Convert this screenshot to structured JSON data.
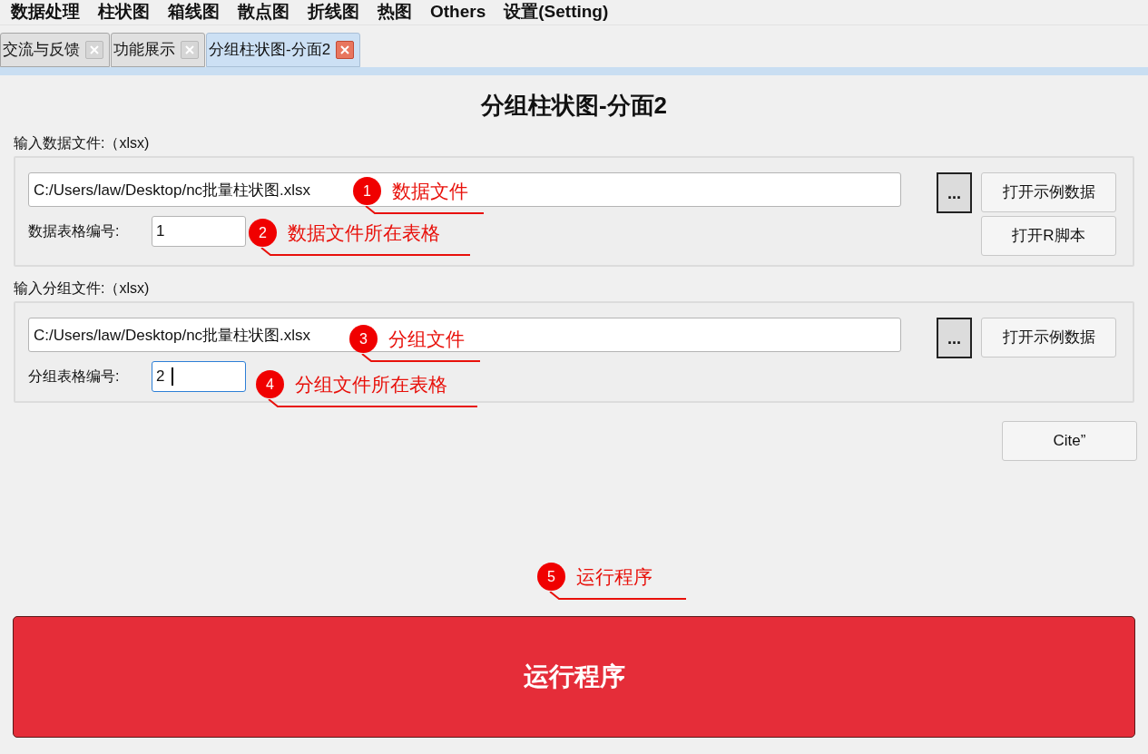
{
  "menu": [
    "数据处理",
    "柱状图",
    "箱线图",
    "散点图",
    "折线图",
    "热图",
    "Others",
    "设置(Setting)"
  ],
  "tabs": [
    {
      "label": "交流与反馈",
      "selected": false
    },
    {
      "label": "功能展示",
      "selected": false
    },
    {
      "label": "分组柱状图-分面2",
      "selected": true
    }
  ],
  "title": "分组柱状图-分面2",
  "sections": [
    {
      "label": "输入数据文件:（xlsx)",
      "file_value": "C:/Users/law/Desktop/nc批量柱状图.xlsx",
      "browse": "...",
      "sheet_label": "数据表格编号:",
      "sheet_value": "1",
      "sheet_focused": false,
      "buttons": [
        "打开示例数据",
        "打开R脚本"
      ]
    },
    {
      "label": "输入分组文件:（xlsx)",
      "file_value": "C:/Users/law/Desktop/nc批量柱状图.xlsx",
      "browse": "...",
      "sheet_label": "分组表格编号:",
      "sheet_value": "2",
      "sheet_focused": true,
      "buttons": [
        "打开示例数据"
      ]
    }
  ],
  "cite_button": "Cite”",
  "run_button": "运行程序",
  "annotations": [
    {
      "number": "1",
      "text": "数据文件"
    },
    {
      "number": "2",
      "text": "数据文件所在表格"
    },
    {
      "number": "3",
      "text": "分组文件"
    },
    {
      "number": "4",
      "text": "分组文件所在表格"
    },
    {
      "number": "5",
      "text": "运行程序"
    }
  ]
}
